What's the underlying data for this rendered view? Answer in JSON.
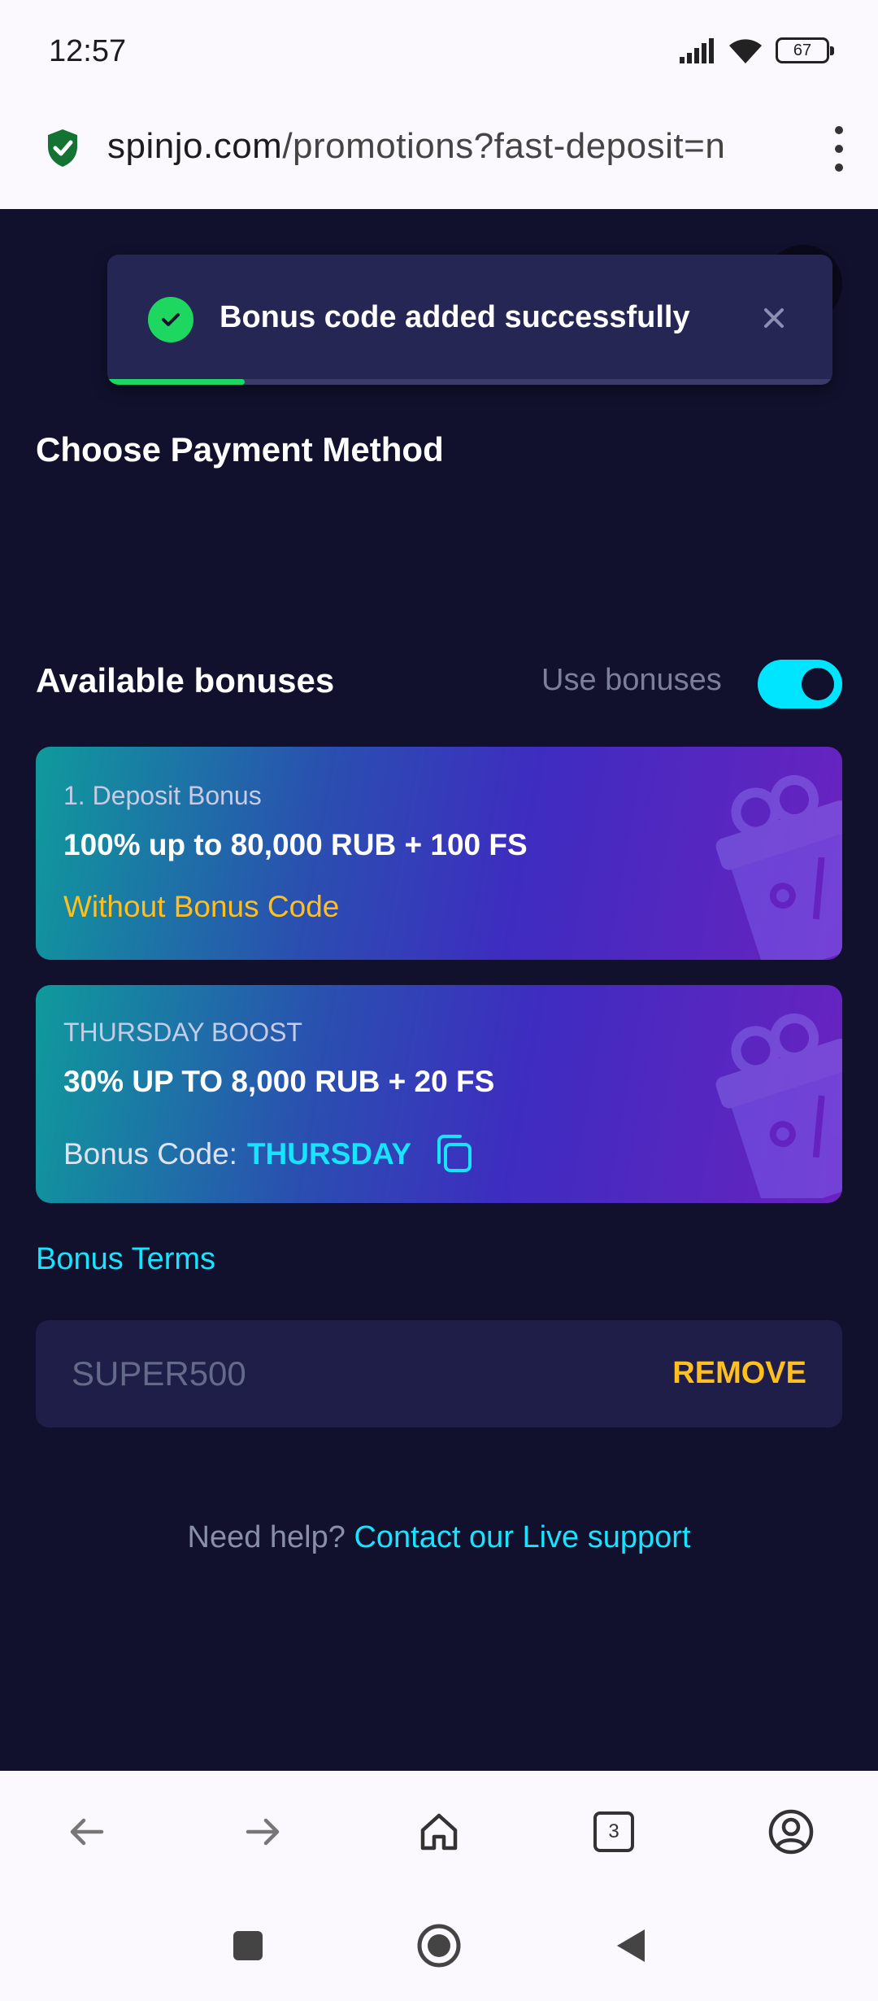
{
  "status": {
    "time": "12:57",
    "battery": "67"
  },
  "browser": {
    "url_domain": "spinjo.com",
    "url_path": "/promotions?fast-deposit=n",
    "tab_count": "3"
  },
  "toast": {
    "message": "Bonus code added successfully",
    "progress": 0.19
  },
  "payment": {
    "title": "Choose Payment Method"
  },
  "bonuses": {
    "title": "Available bonuses",
    "use_label": "Use bonuses",
    "use_enabled": true,
    "cards": [
      {
        "label": "1. Deposit Bonus",
        "headline": "100% up to 80,000 RUB + 100 FS",
        "sub": "Without Bonus Code"
      },
      {
        "label": "THURSDAY BOOST",
        "headline": "30% UP TO 8,000 RUB + 20 FS",
        "code_prefix": "Bonus Code:",
        "code": "THURSDAY"
      }
    ],
    "terms_link": "Bonus Terms"
  },
  "promo": {
    "value": "SUPER500",
    "remove_label": "REMOVE"
  },
  "help": {
    "prefix": "Need help?",
    "link": "Contact our Live support"
  },
  "colors": {
    "accent_cyan": "#17e4ff",
    "accent_gold": "#ffbf1f",
    "success": "#1ed760",
    "page_bg": "#11112e"
  }
}
